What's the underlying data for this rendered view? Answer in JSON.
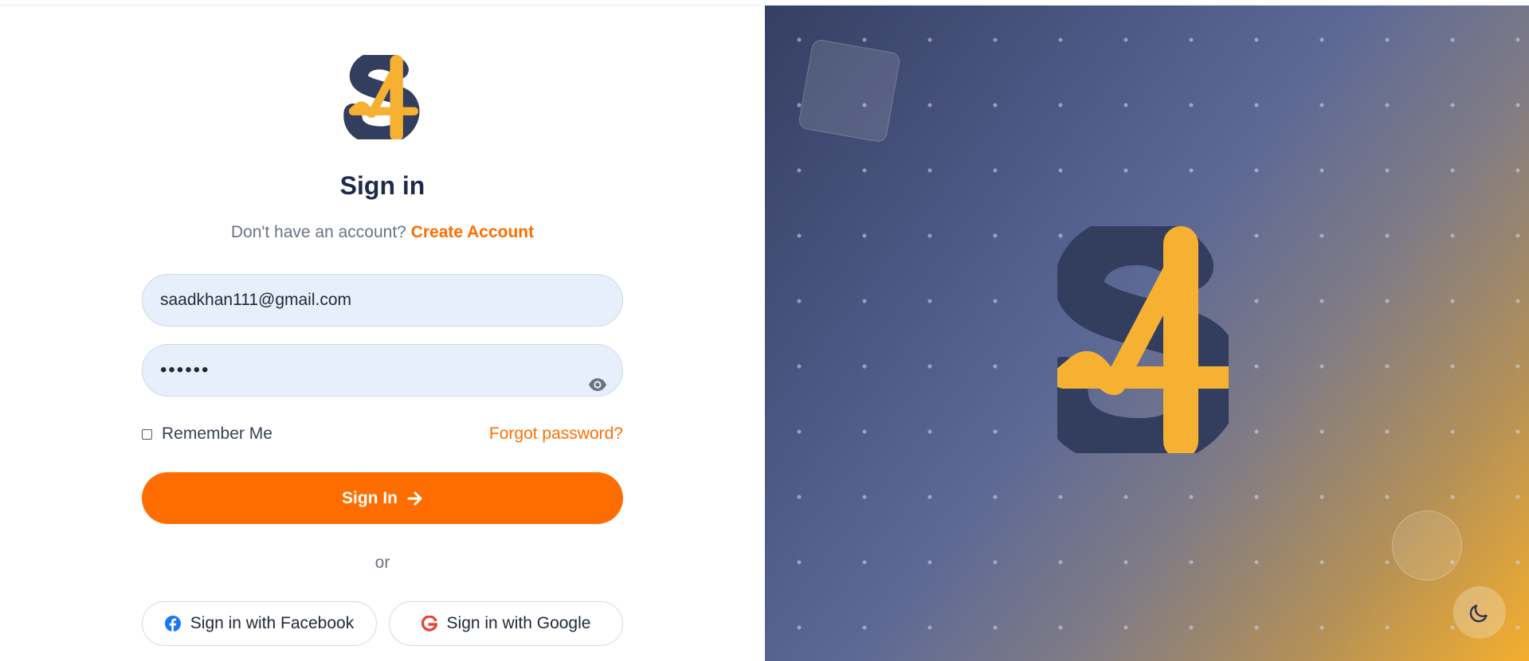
{
  "auth": {
    "title": "Sign in",
    "no_account_text": "Don't have an account?",
    "create_account_link": "Create Account",
    "email_value": "saadkhan111@gmail.com",
    "password_value": "••••••",
    "remember_me_label": "Remember Me",
    "remember_me_checked": false,
    "forgot_password_link": "Forgot password?",
    "sign_in_button": "Sign In",
    "divider_text": "or",
    "facebook_button": "Sign in with Facebook",
    "google_button": "Sign in with Google"
  },
  "icons": {
    "logo": "s4-logo-icon",
    "password_toggle": "eye-icon",
    "sign_in_arrow": "arrow-right-icon",
    "facebook": "facebook-icon",
    "google": "google-icon",
    "theme_toggle": "moon-icon"
  },
  "colors": {
    "brand_orange": "#ff6d00",
    "logo_navy": "#333d5e",
    "logo_yellow": "#f6b132",
    "title_navy": "#1e2a4a"
  }
}
